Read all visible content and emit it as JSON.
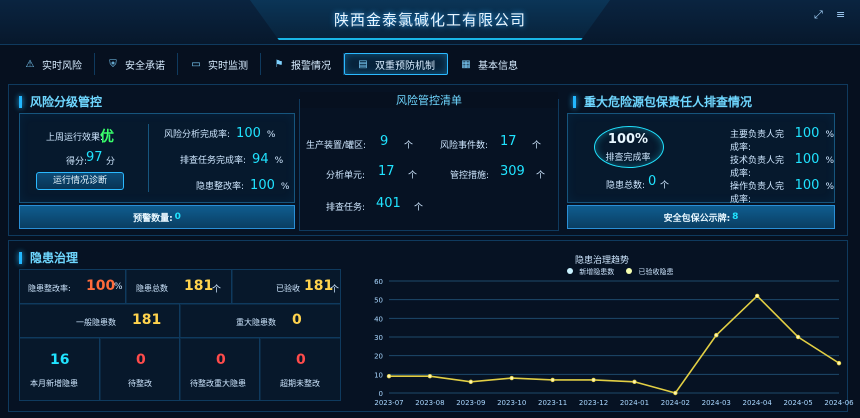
{
  "header": {
    "title": "陕西金泰氯碱化工有限公司",
    "icons": [
      "fullscreen-icon",
      "menu-icon"
    ]
  },
  "tabs": [
    {
      "label": "实时风险",
      "icon": "risk-icon"
    },
    {
      "label": "安全承诺",
      "icon": "shield-icon"
    },
    {
      "label": "实时监测",
      "icon": "monitor-icon"
    },
    {
      "label": "报警情况",
      "icon": "alarm-icon"
    },
    {
      "label": "双重预防机制",
      "icon": "book-icon",
      "active": true
    },
    {
      "label": "基本信息",
      "icon": "doc-icon"
    }
  ],
  "risk_control": {
    "title": "风险分级管控",
    "last_week_effect_label": "上周运行效果:",
    "last_week_effect_value": "优",
    "score_label": "得分:",
    "score_value": "97",
    "score_unit": "分",
    "diagnosis_button": "运行情况诊断",
    "rates": [
      {
        "label": "风险分析完成率:",
        "value": "100",
        "unit": "%"
      },
      {
        "label": "排查任务完成率:",
        "value": "94",
        "unit": "%"
      },
      {
        "label": "隐患整改率:",
        "value": "100",
        "unit": "%"
      }
    ],
    "alert_label": "预警数量:",
    "alert_value": "0"
  },
  "risk_list": {
    "title": "风险管控清单",
    "items": [
      {
        "label": "生产装置/罐区:",
        "value": "9",
        "unit": "个"
      },
      {
        "label": "风险事件数:",
        "value": "17",
        "unit": "个"
      },
      {
        "label": "分析单元:",
        "value": "17",
        "unit": "个"
      },
      {
        "label": "管控措施:",
        "value": "309",
        "unit": "个"
      },
      {
        "label": "排查任务:",
        "value": "401",
        "unit": "个"
      }
    ]
  },
  "major_hazard": {
    "title": "重大危险源包保责任人排查情况",
    "completion_percent": "100%",
    "completion_label": "排查完成率",
    "hidden_danger_total_label": "隐患总数:",
    "hidden_danger_total_value": "0",
    "hidden_danger_total_unit": "个",
    "rates": [
      {
        "label": "主要负责人完成率:",
        "value": "100",
        "unit": "%"
      },
      {
        "label": "技术负责人完成率:",
        "value": "100",
        "unit": "%"
      },
      {
        "label": "操作负责人完成率:",
        "value": "100",
        "unit": "%"
      }
    ],
    "safety_notice_label": "安全包保公示牌:",
    "safety_notice_value": "8"
  },
  "hazard_management": {
    "title": "隐患治理",
    "stats_top": [
      {
        "label": "隐患整改率:",
        "value": "100",
        "unit": "%",
        "color": "#ff6b3b"
      },
      {
        "label": "隐患总数",
        "value": "181",
        "unit": "个",
        "color": "#ffd34d"
      },
      {
        "label": "已验收",
        "value": "181",
        "unit": "个",
        "color": "#ffd34d"
      }
    ],
    "stats_mid": [
      {
        "label": "一般隐患数",
        "value": "181",
        "color": "#ffd34d"
      },
      {
        "label": "重大隐患数",
        "value": "0",
        "color": "#ffd34d"
      }
    ],
    "stats_bottom": [
      {
        "label": "本月新增隐患",
        "value": "16",
        "color": "#20e3ff"
      },
      {
        "label": "待整改",
        "value": "0",
        "color": "#ff4b4b"
      },
      {
        "label": "待整改重大隐患",
        "value": "0",
        "color": "#ff4b4b"
      },
      {
        "label": "超期未整改",
        "value": "0",
        "color": "#ff4b4b"
      }
    ]
  },
  "chart_data": {
    "type": "line",
    "title": "隐患治理趋势",
    "categories": [
      "2023-07",
      "2023-08",
      "2023-09",
      "2023-10",
      "2023-11",
      "2023-12",
      "2024-01",
      "2024-02",
      "2024-03",
      "2024-04",
      "2024-05",
      "2024-06"
    ],
    "series": [
      {
        "name": "新增隐患数",
        "values": [
          9,
          9,
          6,
          8,
          7,
          7,
          6,
          0,
          31,
          52,
          30,
          16
        ],
        "color": "#e2cf44"
      },
      {
        "name": "已验收隐患",
        "values": [],
        "color": "#f6ffb0"
      }
    ],
    "ylim": [
      0,
      60
    ],
    "yticks": [
      0,
      10,
      20,
      30,
      40,
      50,
      60
    ],
    "grid": true,
    "legend": "top-center"
  }
}
